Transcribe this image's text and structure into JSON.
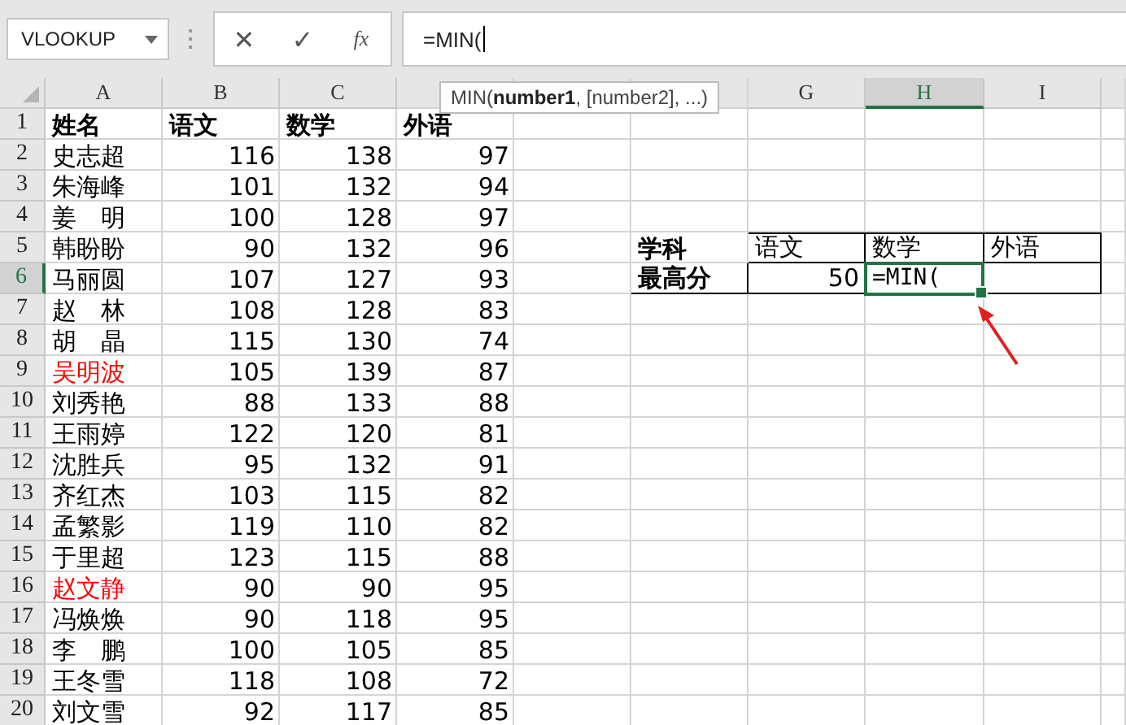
{
  "name_box": "VLOOKUP",
  "formula_bar": {
    "cancel": "✕",
    "enter": "✓",
    "function": "fx",
    "value": "=MIN("
  },
  "tooltip": "MIN(**number1**, [number2], ...)",
  "column_headers_left": [
    {
      "label": "A",
      "selected": false
    },
    {
      "label": "B",
      "selected": false
    },
    {
      "label": "C",
      "selected": false
    }
  ],
  "column_headers_right": [
    {
      "label": "G",
      "selected": false
    },
    {
      "label": "H",
      "selected": true
    },
    {
      "label": "I",
      "selected": false
    }
  ],
  "rows": [
    {
      "num": "1",
      "selected": false,
      "cells": [
        {
          "text": "姓名",
          "bold": true
        },
        {
          "text": "语文",
          "bold": true
        },
        {
          "text": "数学",
          "bold": true
        },
        {
          "text": "外语",
          "bold": true
        }
      ]
    },
    {
      "num": "2",
      "selected": false,
      "cells": [
        {
          "text": "史志超"
        },
        {
          "text": "116",
          "kind": "number"
        },
        {
          "text": "138",
          "kind": "number"
        },
        {
          "text": "97",
          "kind": "number"
        }
      ]
    },
    {
      "num": "3",
      "selected": false,
      "cells": [
        {
          "text": "朱海峰"
        },
        {
          "text": "101",
          "kind": "number"
        },
        {
          "text": "132",
          "kind": "number"
        },
        {
          "text": "94",
          "kind": "number"
        }
      ]
    },
    {
      "num": "4",
      "selected": false,
      "cells": [
        {
          "text": "姜　明"
        },
        {
          "text": "100",
          "kind": "number"
        },
        {
          "text": "128",
          "kind": "number"
        },
        {
          "text": "97",
          "kind": "number"
        }
      ]
    },
    {
      "num": "5",
      "selected": false,
      "cells": [
        {
          "text": "韩盼盼"
        },
        {
          "text": "90",
          "kind": "number"
        },
        {
          "text": "132",
          "kind": "number"
        },
        {
          "text": "96",
          "kind": "number"
        }
      ],
      "summary": [
        {
          "text": "学科",
          "bold": true,
          "boxed": false
        },
        {
          "text": "语文",
          "boxed": true
        },
        {
          "text": "数学",
          "boxed": true
        },
        {
          "text": "外语",
          "boxed": true
        }
      ]
    },
    {
      "num": "6",
      "selected": true,
      "cells": [
        {
          "text": "马丽圆"
        },
        {
          "text": "107",
          "kind": "number"
        },
        {
          "text": "127",
          "kind": "number"
        },
        {
          "text": "93",
          "kind": "number"
        }
      ],
      "summary": [
        {
          "text": "最高分",
          "bold": true,
          "boxed": true
        },
        {
          "text": "50",
          "kind": "number",
          "boxed": true
        },
        {
          "text": "=MIN(",
          "editing": true,
          "boxed": true
        },
        {
          "boxed": true
        }
      ]
    },
    {
      "num": "7",
      "selected": false,
      "cells": [
        {
          "text": "赵　林"
        },
        {
          "text": "108",
          "kind": "number"
        },
        {
          "text": "128",
          "kind": "number"
        },
        {
          "text": "83",
          "kind": "number"
        }
      ]
    },
    {
      "num": "8",
      "selected": false,
      "cells": [
        {
          "text": "胡　晶"
        },
        {
          "text": "115",
          "kind": "number"
        },
        {
          "text": "130",
          "kind": "number"
        },
        {
          "text": "74",
          "kind": "number"
        }
      ]
    },
    {
      "num": "9",
      "selected": false,
      "cells": [
        {
          "text": "吴明波",
          "color": "#ff0000"
        },
        {
          "text": "105",
          "kind": "number"
        },
        {
          "text": "139",
          "kind": "number"
        },
        {
          "text": "87",
          "kind": "number"
        }
      ]
    },
    {
      "num": "10",
      "selected": false,
      "cells": [
        {
          "text": "刘秀艳"
        },
        {
          "text": "88",
          "kind": "number"
        },
        {
          "text": "133",
          "kind": "number"
        },
        {
          "text": "88",
          "kind": "number"
        }
      ]
    },
    {
      "num": "11",
      "selected": false,
      "cells": [
        {
          "text": "王雨婷"
        },
        {
          "text": "122",
          "kind": "number"
        },
        {
          "text": "120",
          "kind": "number"
        },
        {
          "text": "81",
          "kind": "number"
        }
      ]
    },
    {
      "num": "12",
      "selected": false,
      "cells": [
        {
          "text": "沈胜兵"
        },
        {
          "text": "95",
          "kind": "number"
        },
        {
          "text": "132",
          "kind": "number"
        },
        {
          "text": "91",
          "kind": "number"
        }
      ]
    },
    {
      "num": "13",
      "selected": false,
      "cells": [
        {
          "text": "齐红杰"
        },
        {
          "text": "103",
          "kind": "number"
        },
        {
          "text": "115",
          "kind": "number"
        },
        {
          "text": "82",
          "kind": "number"
        }
      ]
    },
    {
      "num": "14",
      "selected": false,
      "cells": [
        {
          "text": "孟繁影"
        },
        {
          "text": "119",
          "kind": "number"
        },
        {
          "text": "110",
          "kind": "number"
        },
        {
          "text": "82",
          "kind": "number"
        }
      ]
    },
    {
      "num": "15",
      "selected": false,
      "cells": [
        {
          "text": "于里超"
        },
        {
          "text": "123",
          "kind": "number"
        },
        {
          "text": "115",
          "kind": "number"
        },
        {
          "text": "88",
          "kind": "number"
        }
      ]
    },
    {
      "num": "16",
      "selected": false,
      "cells": [
        {
          "text": "赵文静",
          "color": "#ff0000"
        },
        {
          "text": "90",
          "kind": "number"
        },
        {
          "text": "90",
          "kind": "number"
        },
        {
          "text": "95",
          "kind": "number"
        }
      ]
    },
    {
      "num": "17",
      "selected": false,
      "cells": [
        {
          "text": "冯焕焕"
        },
        {
          "text": "90",
          "kind": "number"
        },
        {
          "text": "118",
          "kind": "number"
        },
        {
          "text": "95",
          "kind": "number"
        }
      ]
    },
    {
      "num": "18",
      "selected": false,
      "cells": [
        {
          "text": "李　鹏"
        },
        {
          "text": "100",
          "kind": "number"
        },
        {
          "text": "105",
          "kind": "number"
        },
        {
          "text": "85",
          "kind": "number"
        }
      ]
    },
    {
      "num": "19",
      "selected": false,
      "cells": [
        {
          "text": "王冬雪"
        },
        {
          "text": "118",
          "kind": "number"
        },
        {
          "text": "108",
          "kind": "number"
        },
        {
          "text": "72",
          "kind": "number"
        }
      ]
    },
    {
      "num": "20",
      "selected": false,
      "cells": [
        {
          "text": "刘文雪"
        },
        {
          "text": "92",
          "kind": "number"
        },
        {
          "text": "117",
          "kind": "number"
        },
        {
          "text": "85",
          "kind": "number"
        }
      ]
    }
  ]
}
